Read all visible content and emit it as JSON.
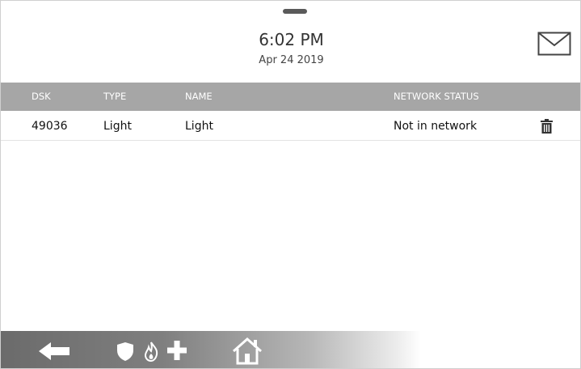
{
  "header": {
    "time": "6:02 PM",
    "date": "Apr 24 2019",
    "message_icon": "envelope-icon"
  },
  "table": {
    "columns": [
      "DSK",
      "TYPE",
      "NAME",
      "NETWORK STATUS"
    ],
    "rows": [
      {
        "dsk": "49036",
        "type": "Light",
        "name": "Light",
        "network_status": "Not in network",
        "action_icon": "trash-icon"
      }
    ]
  },
  "bottom_bar": {
    "icons": [
      "back-arrow-icon",
      "shield-icon",
      "fire-icon",
      "medical-cross-icon",
      "home-icon"
    ]
  },
  "colors": {
    "header_bg": "#a6a6a6",
    "bar_dark": "#6b6b6b"
  }
}
